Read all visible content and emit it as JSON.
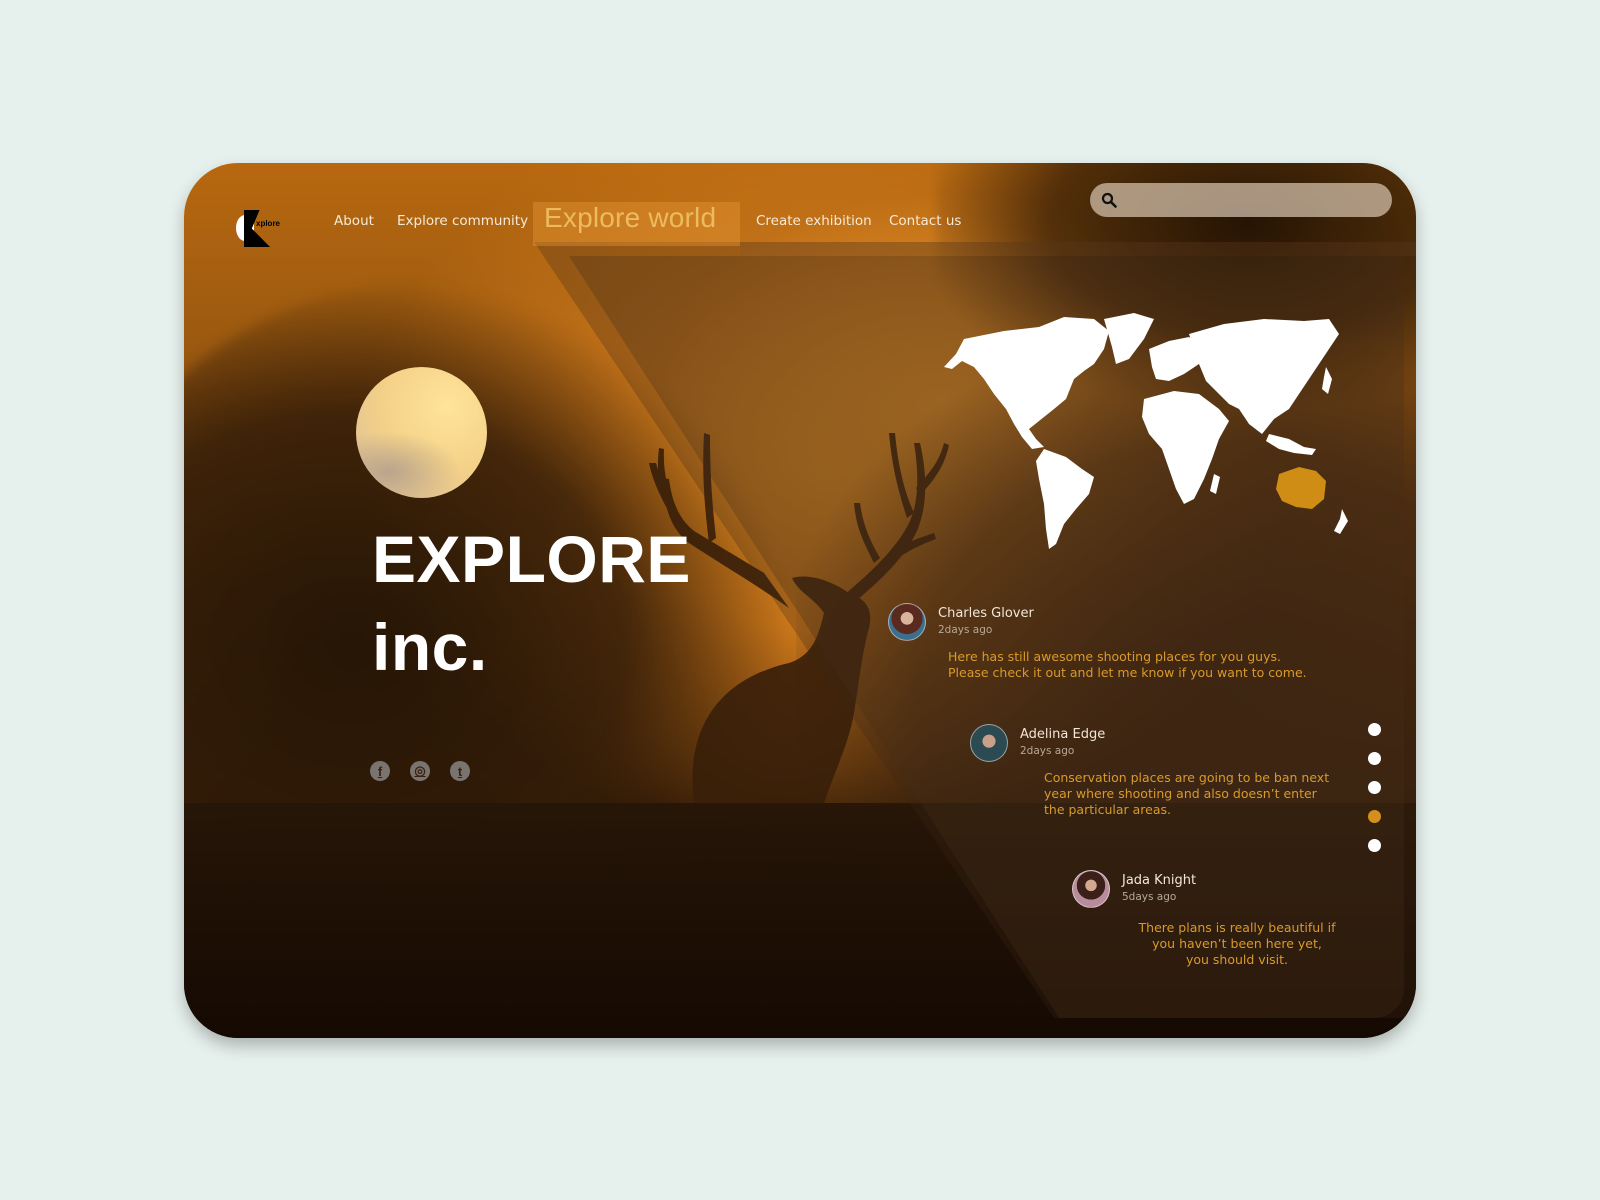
{
  "brand": {
    "logo_text": "xplore"
  },
  "nav": {
    "items": [
      {
        "label": "About",
        "active": false
      },
      {
        "label": "Explore community",
        "active": false
      },
      {
        "label": "Explore world",
        "active": true
      },
      {
        "label": "Create exhibition",
        "active": false
      },
      {
        "label": "Contact us",
        "active": false
      }
    ]
  },
  "search": {
    "placeholder": "",
    "value": "",
    "icon": "search-icon"
  },
  "hero": {
    "title_line1": "EXPLORE",
    "title_line2": "inc."
  },
  "socials": [
    {
      "name": "facebook",
      "glyph": "f"
    },
    {
      "name": "instagram",
      "glyph": "◎"
    },
    {
      "name": "tumblr",
      "glyph": "t"
    }
  ],
  "map": {
    "highlighted_region": "Australia",
    "land_color": "#ffffff",
    "highlight_color": "#d08d16"
  },
  "comments": [
    {
      "name": "Charles Glover",
      "time": "2days ago",
      "message": "Here has still awesome shooting places for you guys.\n     Please check it out and let me know if you want to come."
    },
    {
      "name": "Adelina Edge",
      "time": "2days ago",
      "message": "Conservation places are going to be ban next\n     year where shooting and also doesn’t enter\nthe particular areas."
    },
    {
      "name": "Jada Knight",
      "time": "5days ago",
      "message": "There plans is really beautiful if\nyou haven’t been here yet,\nyou should visit."
    }
  ],
  "pager": {
    "count": 5,
    "active_index": 3,
    "active_color": "#d4901a",
    "inactive_color": "#ffffff"
  },
  "colors": {
    "page_background": "#e6f0ec",
    "accent": "#d99a2a",
    "nav_active": "#f2c66a"
  }
}
